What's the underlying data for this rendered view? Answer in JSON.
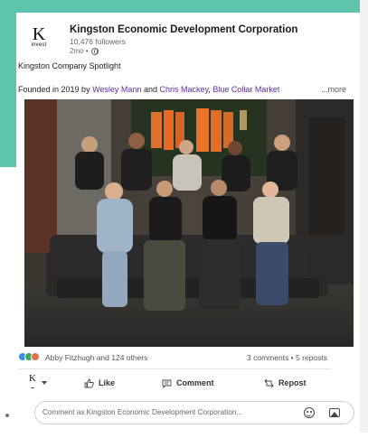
{
  "post": {
    "org_name": "Kingston Economic Development Corporation",
    "logo_letter": "K",
    "logo_sub": "invest",
    "followers": "10,476 followers",
    "time": "2mo •",
    "headline": "Kingston Company Spotlight",
    "founded_prefix": "Founded in 2019 by ",
    "mention1": "Wesley Mann",
    "and_text": " and ",
    "mention2": "Chris Mackey",
    "comma_text": ", ",
    "mention3": "Blue Collar Market",
    "more": "...more"
  },
  "social": {
    "reaction_text": "Abby Fitzhugh and 124 others",
    "counts": "3 comments • 5 reposts"
  },
  "actions": {
    "like": "Like",
    "comment": "Comment",
    "repost": "Repost",
    "avatar_letter": "K"
  },
  "comment_box": {
    "placeholder": "Comment as Kingston Economic Development Corporation..."
  },
  "colors": {
    "accent_teal": "#5ec4ad",
    "mention_purple": "#5b2fa8",
    "like_blue": "#378fe9",
    "celebrate_green": "#44a560",
    "love_red": "#df704d"
  }
}
